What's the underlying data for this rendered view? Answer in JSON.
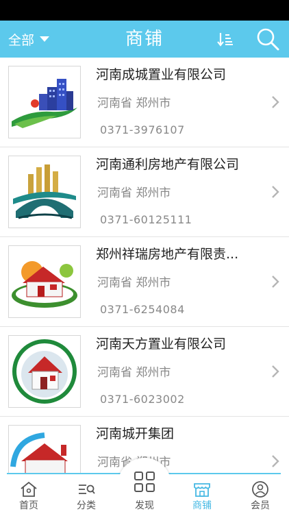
{
  "header": {
    "filter_label": "全部",
    "title": "商铺",
    "sort_icon": "sort-icon",
    "search_icon": "search-icon",
    "background_color": "#5cc9ec"
  },
  "stores": [
    {
      "name": "河南成城置业有限公司",
      "location": "河南省 郑州市",
      "phone": "0371-3976107"
    },
    {
      "name": "河南通利房地产有限公司",
      "location": "河南省 郑州市",
      "phone": "0371-60125111"
    },
    {
      "name": "郑州祥瑞房地产有限责...",
      "location": "河南省 郑州市",
      "phone": "0371-6254084"
    },
    {
      "name": "河南天方置业有限公司",
      "location": "河南省 郑州市",
      "phone": "0371-6023002"
    },
    {
      "name": "河南城开集团",
      "location": "河南省 郑州市",
      "phone": ""
    }
  ],
  "tabbar": {
    "active_color": "#45b8e3",
    "tabs": [
      {
        "label": "首页",
        "icon": "home-icon"
      },
      {
        "label": "分类",
        "icon": "category-icon"
      },
      {
        "label": "发现",
        "icon": "discover-grid-icon"
      },
      {
        "label": "商铺",
        "icon": "store-icon",
        "active": true
      },
      {
        "label": "会员",
        "icon": "member-icon"
      }
    ]
  }
}
